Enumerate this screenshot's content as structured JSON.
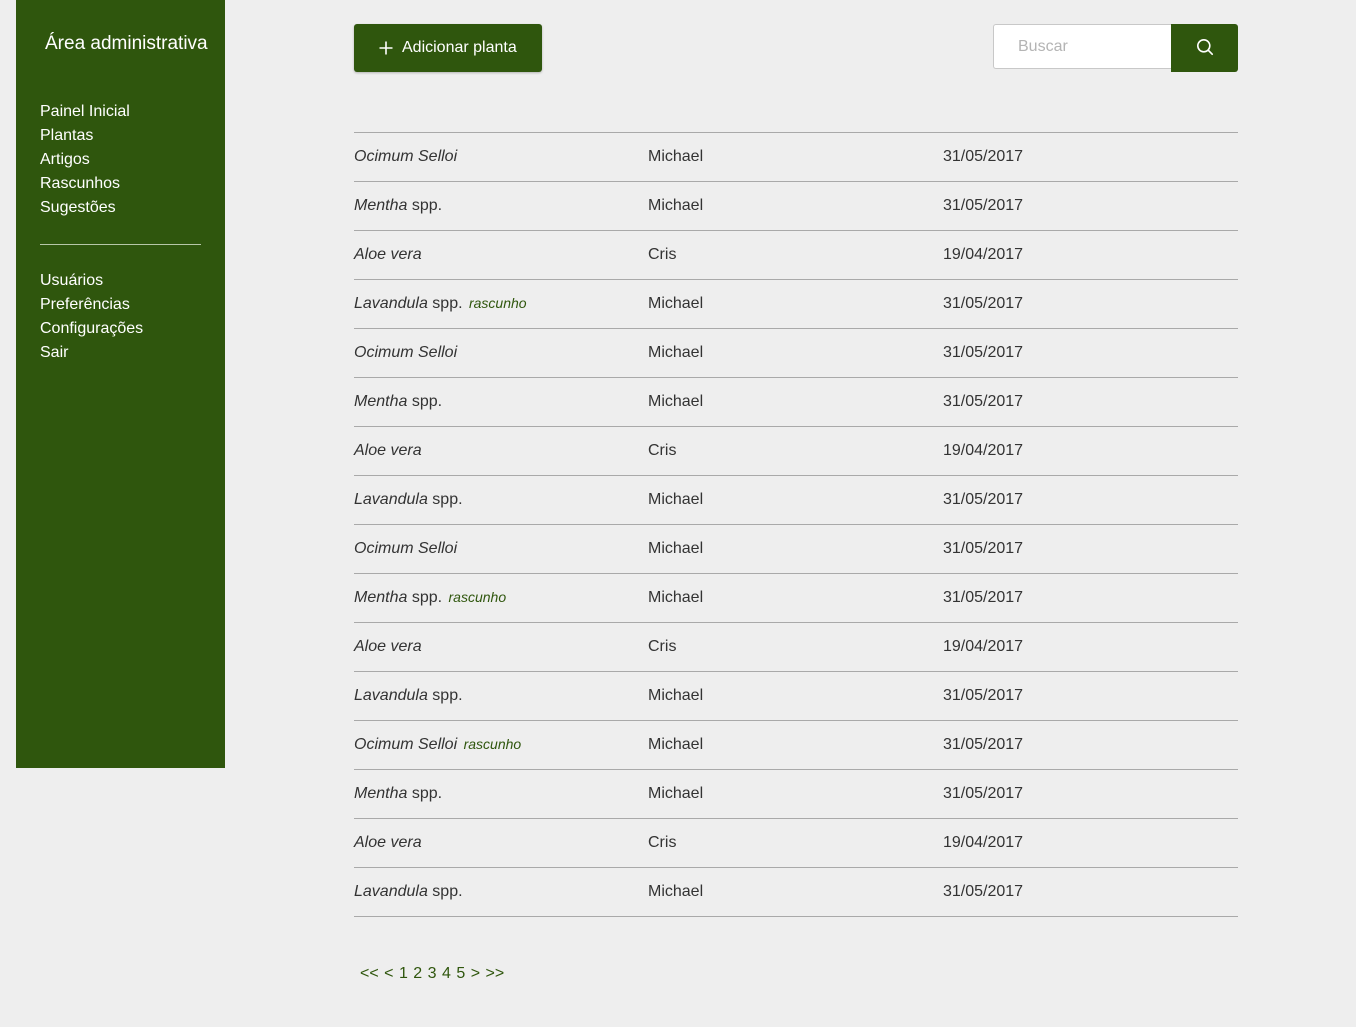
{
  "sidebar": {
    "title": "Área administrativa",
    "primary_items": [
      {
        "label": "Painel Inicial",
        "name": "sidebar-item-painel-inicial"
      },
      {
        "label": "Plantas",
        "name": "sidebar-item-plantas"
      },
      {
        "label": "Artigos",
        "name": "sidebar-item-artigos"
      },
      {
        "label": "Rascunhos",
        "name": "sidebar-item-rascunhos"
      },
      {
        "label": "Sugestões",
        "name": "sidebar-item-sugestoes"
      }
    ],
    "secondary_items": [
      {
        "label": "Usuários",
        "name": "sidebar-item-usuarios"
      },
      {
        "label": "Preferências",
        "name": "sidebar-item-preferencias"
      },
      {
        "label": "Configurações",
        "name": "sidebar-item-configuracoes"
      },
      {
        "label": "Sair",
        "name": "sidebar-item-sair"
      }
    ]
  },
  "toolbar": {
    "add_label": "Adicionar planta",
    "add_icon": "plus-icon",
    "search_placeholder": "Buscar",
    "search_value": "",
    "search_icon": "search-icon"
  },
  "plants": [
    {
      "genus": "Ocimum Selloi",
      "suffix": "",
      "draft": "",
      "author": "Michael",
      "date": "31/05/2017"
    },
    {
      "genus": "Mentha",
      "suffix": " spp.",
      "draft": "",
      "author": "Michael",
      "date": "31/05/2017"
    },
    {
      "genus": "Aloe vera",
      "suffix": "",
      "draft": "",
      "author": "Cris",
      "date": "19/04/2017"
    },
    {
      "genus": "Lavandula",
      "suffix": " spp.",
      "draft": "rascunho",
      "author": "Michael",
      "date": "31/05/2017"
    },
    {
      "genus": "Ocimum Selloi",
      "suffix": "",
      "draft": "",
      "author": "Michael",
      "date": "31/05/2017"
    },
    {
      "genus": "Mentha",
      "suffix": " spp.",
      "draft": "",
      "author": "Michael",
      "date": "31/05/2017"
    },
    {
      "genus": "Aloe vera",
      "suffix": "",
      "draft": "",
      "author": "Cris",
      "date": "19/04/2017"
    },
    {
      "genus": "Lavandula",
      "suffix": " spp.",
      "draft": "",
      "author": "Michael",
      "date": "31/05/2017"
    },
    {
      "genus": "Ocimum Selloi",
      "suffix": "",
      "draft": "",
      "author": "Michael",
      "date": "31/05/2017"
    },
    {
      "genus": "Mentha",
      "suffix": " spp.",
      "draft": "rascunho",
      "author": "Michael",
      "date": "31/05/2017"
    },
    {
      "genus": "Aloe vera",
      "suffix": "",
      "draft": "",
      "author": "Cris",
      "date": "19/04/2017"
    },
    {
      "genus": "Lavandula",
      "suffix": " spp.",
      "draft": "",
      "author": "Michael",
      "date": "31/05/2017"
    },
    {
      "genus": "Ocimum Selloi",
      "suffix": "",
      "draft": "rascunho",
      "author": "Michael",
      "date": "31/05/2017"
    },
    {
      "genus": "Mentha",
      "suffix": " spp.",
      "draft": "",
      "author": "Michael",
      "date": "31/05/2017"
    },
    {
      "genus": "Aloe vera",
      "suffix": "",
      "draft": "",
      "author": "Cris",
      "date": "19/04/2017"
    },
    {
      "genus": "Lavandula",
      "suffix": " spp.",
      "draft": "",
      "author": "Michael",
      "date": "31/05/2017"
    }
  ],
  "pagination": {
    "first": "<<",
    "prev": "<",
    "pages": [
      "1",
      "2",
      "3",
      "4",
      "5"
    ],
    "next": ">",
    "last": ">>"
  },
  "colors": {
    "brand": "#2f560d",
    "background": "#eeeeee",
    "text": "#333333",
    "divider": "#a9a9a9"
  }
}
